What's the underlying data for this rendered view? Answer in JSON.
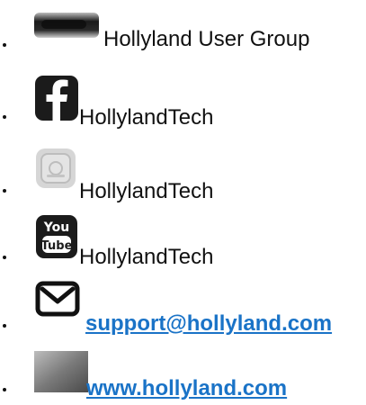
{
  "contacts": [
    {
      "icon": "user-group-icon",
      "label": "Hollyland User Group",
      "kind": "text"
    },
    {
      "icon": "facebook-icon",
      "label": "HollylandTech",
      "kind": "text"
    },
    {
      "icon": "instagram-icon",
      "label": "HollylandTech",
      "kind": "text"
    },
    {
      "icon": "youtube-icon",
      "label": "HollylandTech",
      "kind": "text"
    },
    {
      "icon": "mail-icon",
      "label": "support@hollyland.com",
      "kind": "link"
    },
    {
      "icon": "website-icon",
      "label": "www.hollyland.com",
      "kind": "link"
    }
  ],
  "colors": {
    "link": "#1a73c7",
    "text": "#111111",
    "icon_dark": "#1b1b1b",
    "icon_gray": "#cfcfcf"
  }
}
